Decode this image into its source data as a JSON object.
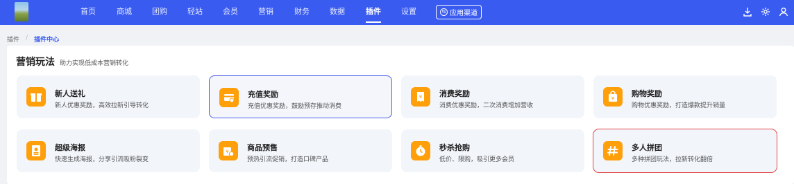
{
  "nav": {
    "items": [
      "首页",
      "商城",
      "团购",
      "轻站",
      "会员",
      "营销",
      "财务",
      "数据",
      "插件",
      "设置"
    ],
    "active": "插件",
    "channel_button": "应用渠道",
    "right_icons": [
      "download-icon",
      "gear-icon",
      "user-icon"
    ],
    "accent": "#3a5bf0"
  },
  "breadcrumb": {
    "root": "插件",
    "separator": "/",
    "current": "插件中心"
  },
  "section": {
    "title": "营销玩法",
    "subtitle": "助力实现低成本营销转化"
  },
  "cards": [
    {
      "title": "新人送礼",
      "desc": "新人优惠奖励，高效拉新引导转化",
      "icon": "gift-box-icon"
    },
    {
      "title": "充值奖励",
      "desc": "充值优惠奖励，鼓励预存推动消费",
      "icon": "card-topup-icon",
      "selected": true
    },
    {
      "title": "消费奖励",
      "desc": "消费优惠奖励，二次消费增加营收",
      "icon": "receipt-yen-icon"
    },
    {
      "title": "购物奖励",
      "desc": "购物优惠奖励，打造爆款提升销量",
      "icon": "shopping-bag-icon"
    },
    {
      "title": "超级海报",
      "desc": "快速生成海报，分享引流吸粉裂变",
      "icon": "poster-icon"
    },
    {
      "title": "商品预售",
      "desc": "预热引流促销，打造口碑产品",
      "icon": "presale-bag-icon"
    },
    {
      "title": "秒杀抢购",
      "desc": "低价、限购，吸引更多会员",
      "icon": "stopwatch-icon"
    },
    {
      "title": "多人拼团",
      "desc": "多种拼团玩法，拉新转化翻倍",
      "icon": "group-buy-icon",
      "highlighted": true
    }
  ],
  "colors": {
    "icon_bg": "#ff9f0a",
    "selected_border": "#4b5ee6",
    "highlight_border": "#e04545"
  }
}
